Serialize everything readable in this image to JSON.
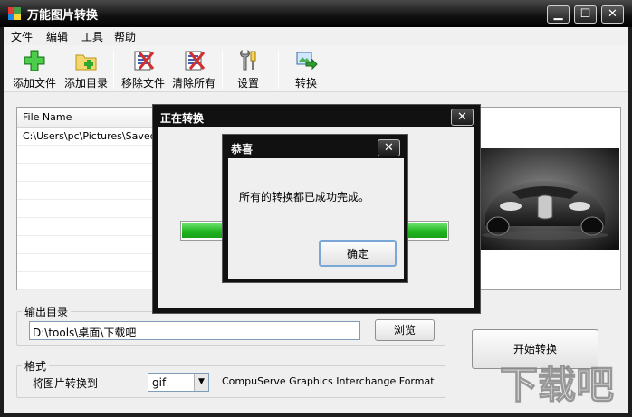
{
  "window": {
    "title": "万能图片转换"
  },
  "caption_buttons": {
    "minimize": "▁",
    "maximize": "☐",
    "close": "✕"
  },
  "menu": [
    "文件",
    "编辑",
    "工具",
    "帮助"
  ],
  "toolbar": {
    "add_file": "添加文件",
    "add_folder": "添加目录",
    "remove_file": "移除文件",
    "clear_all": "清除所有",
    "settings": "设置",
    "convert": "转换"
  },
  "file_list": {
    "column": "File Name",
    "rows": [
      "C:\\Users\\pc\\Pictures\\Saved P"
    ]
  },
  "output": {
    "label": "输出目录",
    "path": "D:\\tools\\桌面\\下载吧",
    "browse": "浏览"
  },
  "format": {
    "label": "格式",
    "convert_to": "将图片转换到",
    "selected": "gif",
    "description": "CompuServe Graphics Interchange Format"
  },
  "start_button": "开始转换",
  "progress_dialog": {
    "title": "正在转换",
    "progress": [
      1.0,
      1.0
    ]
  },
  "congrats_dialog": {
    "title": "恭喜",
    "message": "所有的转换都已成功完成。",
    "ok": "确定"
  },
  "watermark": "下载吧",
  "colors": {
    "titlebar": "#111111",
    "progress": "#1fb51f",
    "accent": "#7aa7d8"
  }
}
